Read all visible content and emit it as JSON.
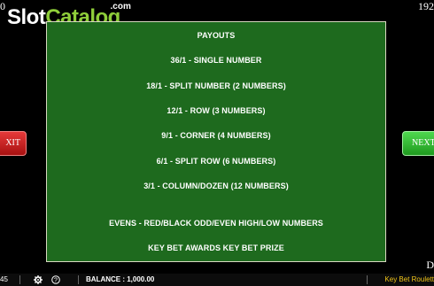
{
  "corners": {
    "top_left": "0",
    "top_right": "192",
    "bottom_right": "D"
  },
  "logo": {
    "part1": "Slot",
    "part2": "Catalog",
    "suffix": ".com"
  },
  "payouts": {
    "title": "PAYOUTS",
    "lines": [
      "36/1 - SINGLE NUMBER",
      "18/1 - SPLIT NUMBER (2 NUMBERS)",
      "12/1 - ROW (3 NUMBERS)",
      "9/1 - CORNER (4 NUMBERS)",
      "6/1 - SPLIT ROW (6 NUMBERS)",
      "3/1 - COLUMN/DOZEN (12 NUMBERS)",
      "EVENS - RED/BLACK ODD/EVEN HIGH/LOW NUMBERS",
      "KEY BET AWARDS KEY BET PRIZE"
    ]
  },
  "nav": {
    "exit_label": "XIT",
    "next_label": "NEXT"
  },
  "bottom_bar": {
    "left_value": "45",
    "balance_text": "BALANCE : 1,000.00",
    "game_name": "Key Bet Roulett",
    "settings_icon": "gear-icon",
    "help_icon": "help-icon"
  }
}
